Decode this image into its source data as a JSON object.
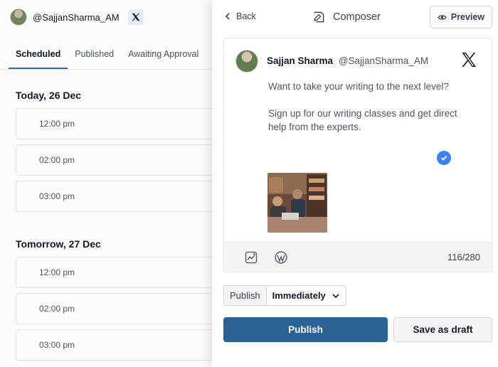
{
  "account": {
    "handle": "@SajjanSharma_AM",
    "network_icon": "x-logo-icon"
  },
  "tabs": [
    {
      "label": "Scheduled",
      "active": true
    },
    {
      "label": "Published",
      "active": false
    },
    {
      "label": "Awaiting Approval",
      "active": false
    }
  ],
  "schedule": [
    {
      "day": "Today, 26 Dec",
      "slots": [
        "12:00 pm",
        "02:00 pm",
        "03:00 pm"
      ]
    },
    {
      "day": "Tomorrow, 27 Dec",
      "slots": [
        "12:00 pm",
        "02:00 pm",
        "03:00 pm"
      ]
    }
  ],
  "composer": {
    "back_label": "Back",
    "title": "Composer",
    "preview_label": "Preview",
    "post": {
      "author_name": "Sajjan Sharma",
      "author_handle": "@SajjanSharma_AM",
      "paragraph_1": "Want to take your writing to the next level?",
      "paragraph_2": "Sign up for our writing classes and get direct help from the experts.",
      "char_count": "116/280"
    },
    "publish_select": {
      "label": "Publish",
      "value": "Immediately"
    },
    "publish_button": "Publish",
    "draft_button": "Save as draft"
  },
  "colors": {
    "primary": "#2b6296",
    "tab_underline": "#2f6db3",
    "check": "#3b82f6"
  }
}
